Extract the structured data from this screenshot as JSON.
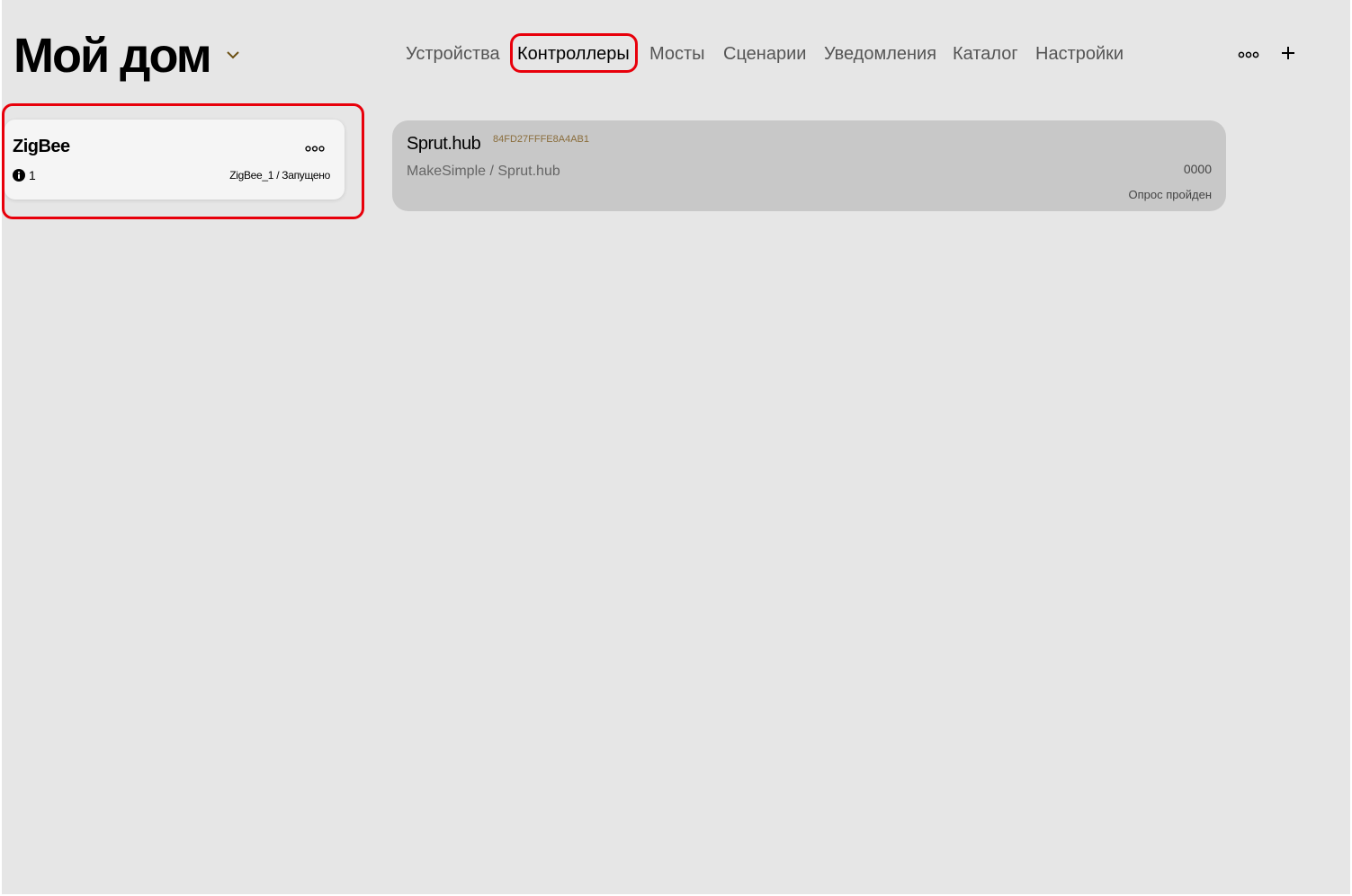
{
  "header": {
    "title": "Мой дом",
    "tabs": [
      {
        "label": "Устройства"
      },
      {
        "label": "Контроллеры"
      },
      {
        "label": "Мосты"
      },
      {
        "label": "Сценарии"
      },
      {
        "label": "Уведомления"
      },
      {
        "label": "Каталог"
      },
      {
        "label": "Настройки"
      }
    ],
    "active_tab": "Контроллеры",
    "icons": [
      "chevron-down-icon",
      "more-icon",
      "plus-icon"
    ]
  },
  "controller": {
    "name": "ZigBee",
    "count": "1",
    "status": "ZigBee_1 / Запущено",
    "icons": [
      "info-icon",
      "more-icon"
    ]
  },
  "device": {
    "name": "Sprut.hub",
    "id": "84FD27FFFE8A4AB1",
    "maker": "MakeSimple / Sprut.hub",
    "code": "0000",
    "status": "Опрос пройден"
  },
  "colors": {
    "background": "#e6e6e6",
    "highlight": "#e8000b",
    "accent": "#8a6d3b",
    "device_card": "#c8c8c8",
    "controller_card": "#f5f5f5"
  }
}
